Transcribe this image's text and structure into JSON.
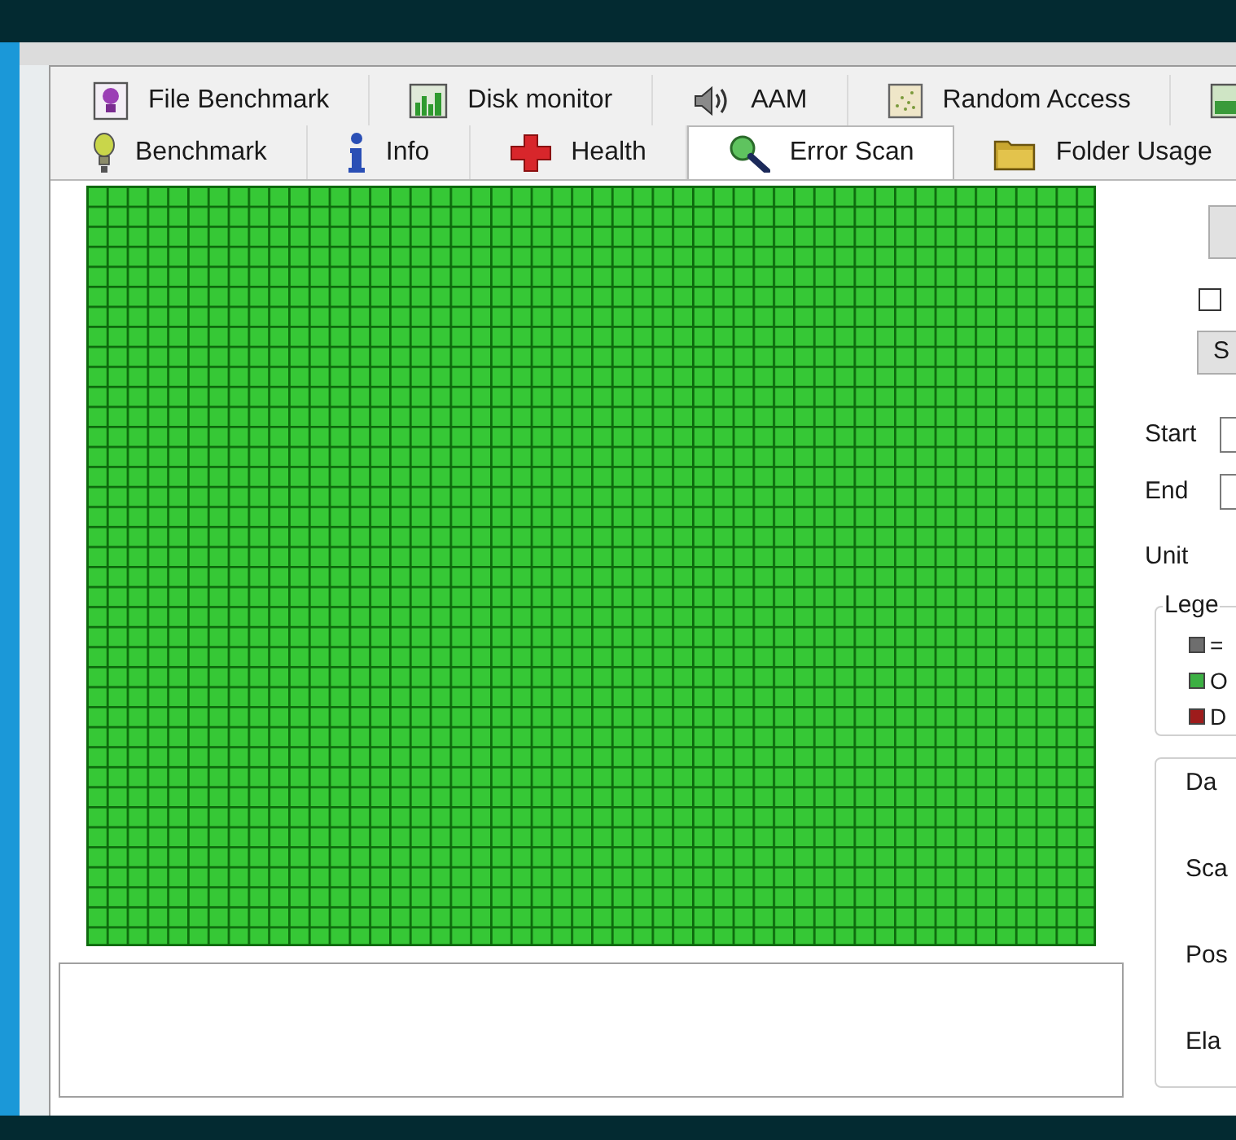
{
  "tabs": {
    "rows": [
      [
        {
          "label": "File Benchmark",
          "selected": false
        },
        {
          "label": "Disk monitor",
          "selected": false
        },
        {
          "label": "AAM",
          "selected": false
        },
        {
          "label": "Random Access",
          "selected": false
        },
        {
          "selected": false
        }
      ],
      [
        {
          "label": "Benchmark",
          "selected": false
        },
        {
          "label": "Info",
          "selected": false
        },
        {
          "label": "Health",
          "selected": false
        },
        {
          "label": "Error Scan",
          "selected": true
        },
        {
          "label": "Folder Usage",
          "selected": false
        }
      ]
    ]
  },
  "side_panel": {
    "checkbox": {
      "checked": false
    },
    "second_button": {
      "label": "S"
    },
    "fields": [
      {
        "label": "Start"
      },
      {
        "label": "End"
      }
    ],
    "unit_label": "Unit",
    "legend": {
      "title": "Lege",
      "items": [
        {
          "label": "=",
          "color": "#6e6e6e"
        },
        {
          "label": "O",
          "color": "#3cb043"
        },
        {
          "label": "D",
          "color": "#9e1c1c"
        }
      ]
    },
    "info_group": {
      "labels": [
        "Da",
        "Sca",
        "Pos",
        "Ela"
      ]
    }
  }
}
